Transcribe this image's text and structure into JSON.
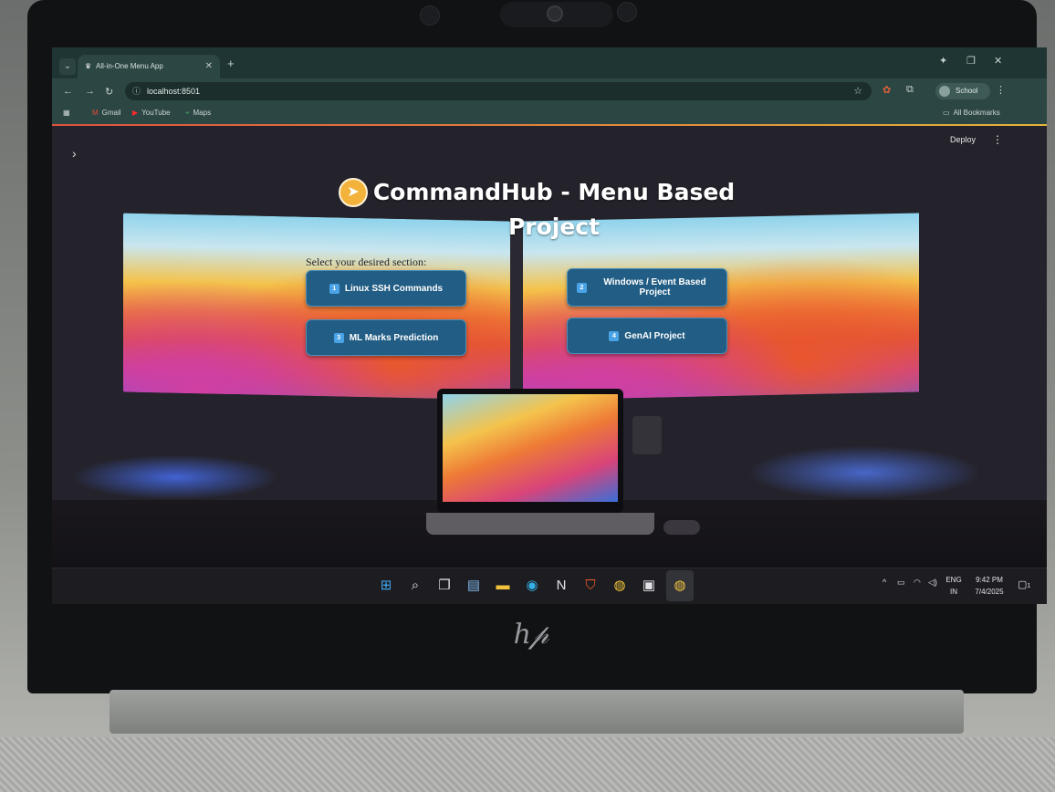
{
  "browser": {
    "tab_title": "All-in-One Menu App",
    "new_tab": "+",
    "url": "localhost:8501",
    "profile": "School",
    "bookmarks": [
      {
        "label": "Gmail",
        "icon": "gmail-icon"
      },
      {
        "label": "YouTube",
        "icon": "youtube-icon"
      },
      {
        "label": "Maps",
        "icon": "maps-icon"
      }
    ],
    "all_bookmarks": "All Bookmarks"
  },
  "app": {
    "deploy_label": "Deploy",
    "title": "CommandHub - Menu Based Project",
    "prompt": "Select your desired section:",
    "buttons": [
      {
        "num": "1",
        "label": "Linux SSH Commands"
      },
      {
        "num": "2",
        "label": "Windows / Event Based Project"
      },
      {
        "num": "3",
        "label": "ML Marks Prediction"
      },
      {
        "num": "4",
        "label": "GenAI Project"
      }
    ]
  },
  "taskbar": {
    "lang_top": "ENG",
    "lang_bottom": "IN",
    "time": "9:42 PM",
    "date": "7/4/2025",
    "notification_count": "1"
  },
  "colors": {
    "accent_tabstrip": "#1f3533",
    "button_bg": "#215d84",
    "badge": "#4aa3e6"
  }
}
